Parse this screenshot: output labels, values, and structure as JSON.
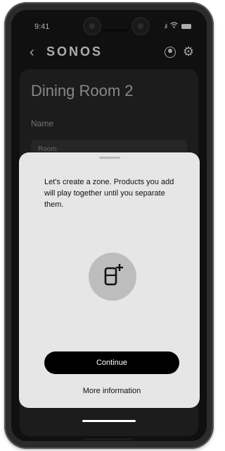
{
  "status_bar": {
    "time": "9:41"
  },
  "header": {
    "brand": "SONOS",
    "back_icon": "chevron-left",
    "account_icon": "account-circle",
    "settings_icon": "gear"
  },
  "background_screen": {
    "room_title": "Dining Room 2",
    "name_label": "Name",
    "room_field_value": "Room"
  },
  "sheet": {
    "message": "Let's create a zone. Products you add will play together until you separate them.",
    "icon": "add-speaker",
    "continue_label": "Continue",
    "more_info_label": "More information"
  },
  "colors": {
    "sheet_background": "#e6e6e6",
    "primary_button": "#000000",
    "screen_background": "#161616",
    "icon_circle": "#bdbdbd"
  }
}
